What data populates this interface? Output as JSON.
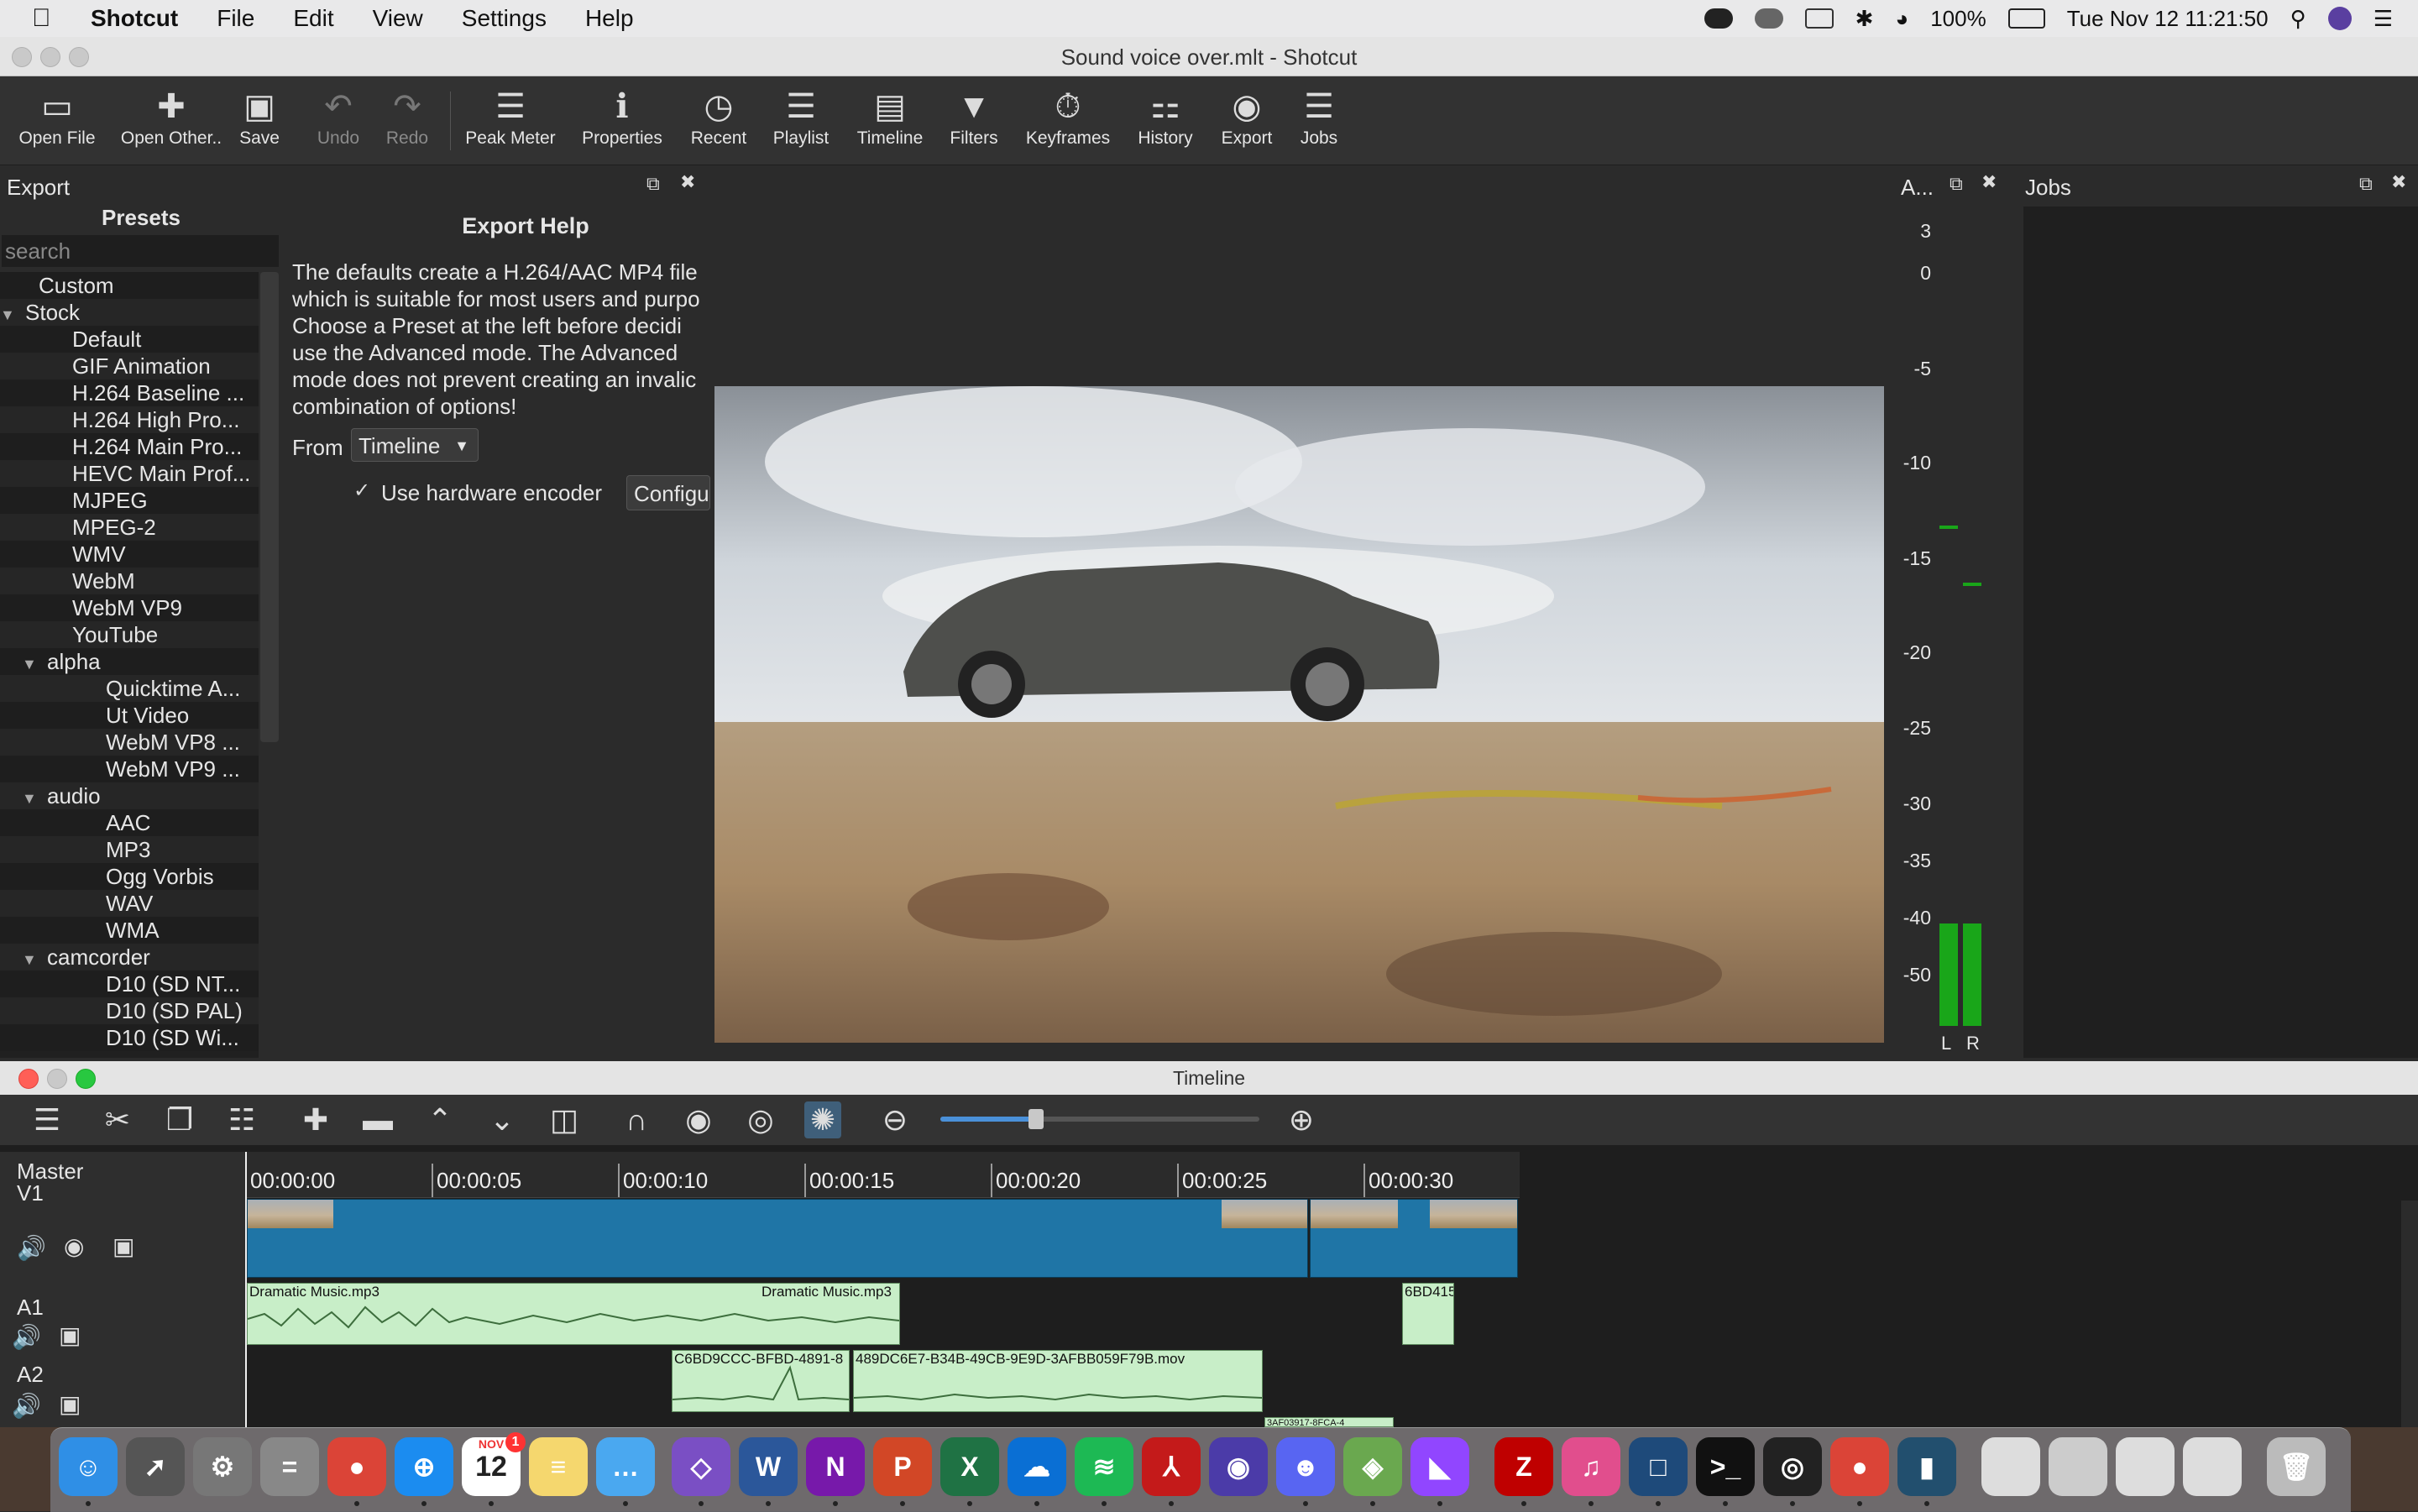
{
  "menubar": {
    "app_name": "Shotcut",
    "menus": [
      "File",
      "Edit",
      "View",
      "Settings",
      "Help"
    ],
    "battery": "100%",
    "clock": "Tue Nov 12  11:21:50"
  },
  "window": {
    "title": "Sound voice over.mlt - Shotcut"
  },
  "toolbar": {
    "open_file": "Open File",
    "open_other": "Open Other..",
    "save": "Save",
    "undo": "Undo",
    "redo": "Redo",
    "peak_meter": "Peak Meter",
    "properties": "Properties",
    "recent": "Recent",
    "playlist": "Playlist",
    "timeline": "Timeline",
    "filters": "Filters",
    "keyframes": "Keyframes",
    "history": "History",
    "export": "Export",
    "jobs": "Jobs"
  },
  "export_panel": {
    "title": "Export",
    "presets_title": "Presets",
    "search_placeholder": "search",
    "tree": [
      "Custom",
      "Stock",
      "Default",
      "GIF Animation",
      "H.264 Baseline ...",
      "H.264 High Pro...",
      "H.264 Main Pro...",
      "HEVC Main Prof...",
      "MJPEG",
      "MPEG-2",
      "WMV",
      "WebM",
      "WebM VP9",
      "YouTube",
      "alpha",
      "Quicktime A...",
      "Ut Video",
      "WebM VP8 ...",
      "WebM VP9 ...",
      "audio",
      "AAC",
      "MP3",
      "Ogg Vorbis",
      "WAV",
      "WMA",
      "camcorder",
      "D10 (SD NT...",
      "D10 (SD PAL)",
      "D10 (SD Wi..."
    ],
    "help_title": "Export Help",
    "help_lines": [
      "The defaults create a H.264/AAC MP4 file",
      "which is suitable for most users and purpo",
      "Choose a Preset at the left before decidi",
      "use the Advanced mode. The Advanced",
      "mode does not prevent creating an invalic",
      "combination of options!"
    ],
    "from_label": "From",
    "from_value": "Timeline",
    "hw_encoder_label": "Use hardware encoder",
    "configure_label": "Configu"
  },
  "audio_meter": {
    "title": "A...",
    "ticks": [
      "3",
      "0",
      "-5",
      "-10",
      "-15",
      "-20",
      "-25",
      "-30",
      "-35",
      "-40",
      "-50"
    ],
    "left_label": "L",
    "right_label": "R",
    "left_level_db": -40,
    "right_level_db": -40,
    "left_peak_db": -13,
    "right_peak_db": -16
  },
  "jobs_panel": {
    "title": "Jobs"
  },
  "timeline": {
    "title": "Timeline",
    "zoom_level": 0.3,
    "master_label": "Master",
    "ruler": [
      "00:00:00",
      "00:00:05",
      "00:00:10",
      "00:00:15",
      "00:00:20",
      "00:00:25",
      "00:00:30"
    ],
    "tracks": [
      "V1",
      "A1",
      "A2"
    ],
    "a1_clip_1": "Dramatic Music.mp3",
    "a1_clip_1b": "Dramatic Music.mp3",
    "a1_clip_2": "6BD415",
    "a2_clip_1": "C6BD9CCC-BFBD-4891-8",
    "a2_clip_2": "489DC6E7-B34B-49CB-9E9D-3AFBB059F79B.mov",
    "a2_clip_3": "3AF03917-8FCA-4"
  },
  "dock": {
    "calendar_month": "NOV",
    "calendar_day": "12",
    "calendar_badge": "1"
  }
}
